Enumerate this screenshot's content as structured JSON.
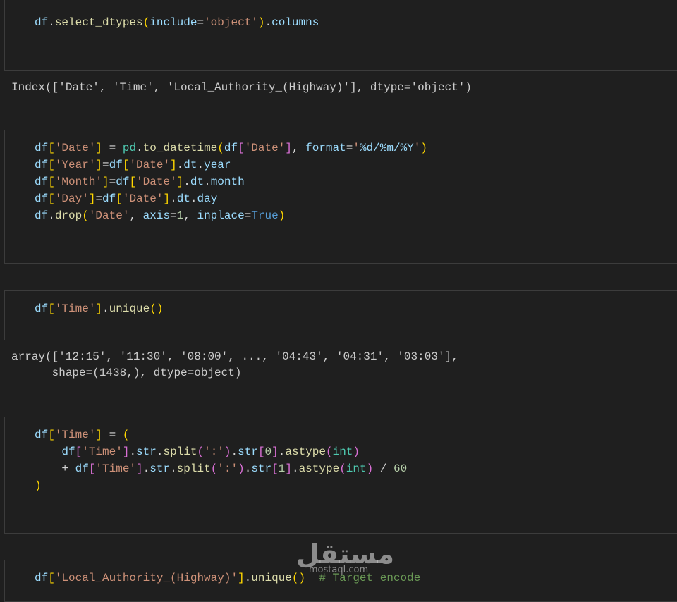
{
  "cells": [
    {
      "lines": [
        [
          "df",
          ".",
          "select_dtypes",
          "(",
          "include",
          "=",
          "'object'",
          ")",
          ".",
          "columns"
        ]
      ]
    },
    {
      "lines": [
        [
          "df",
          "[",
          "'Date'",
          "]",
          " = ",
          "pd",
          ".",
          "to_datetime",
          "(",
          "df",
          "[",
          "'Date'",
          "]",
          ", ",
          "format",
          "=",
          "'",
          "%d/%m/%Y",
          "'",
          ")"
        ],
        [
          "df",
          "[",
          "'Year'",
          "]",
          "=",
          "df",
          "[",
          "'Date'",
          "]",
          ".",
          "dt",
          ".",
          "year"
        ],
        [
          "df",
          "[",
          "'Month'",
          "]",
          "=",
          "df",
          "[",
          "'Date'",
          "]",
          ".",
          "dt",
          ".",
          "month"
        ],
        [
          "df",
          "[",
          "'Day'",
          "]",
          "=",
          "df",
          "[",
          "'Date'",
          "]",
          ".",
          "dt",
          ".",
          "day"
        ],
        [
          "df",
          ".",
          "drop",
          "(",
          "'Date'",
          ", ",
          "axis",
          "=",
          "1",
          ", ",
          "inplace",
          "=",
          "True",
          ")"
        ]
      ]
    },
    {
      "lines": [
        [
          "df",
          "[",
          "'Time'",
          "]",
          ".",
          "unique",
          "(",
          ")"
        ]
      ]
    },
    {
      "lines": [
        [
          "df",
          "[",
          "'Time'",
          "]",
          " = ",
          "("
        ],
        [
          "    ",
          "df",
          "[",
          "'Time'",
          "]",
          ".",
          "str",
          ".",
          "split",
          "(",
          "':'",
          ")",
          ".",
          "str",
          "[",
          "0",
          "]",
          ".",
          "astype",
          "(",
          "int",
          ")"
        ],
        [
          "    ",
          "+ ",
          "df",
          "[",
          "'Time'",
          "]",
          ".",
          "str",
          ".",
          "split",
          "(",
          "':'",
          ")",
          ".",
          "str",
          "[",
          "1",
          "]",
          ".",
          "astype",
          "(",
          "int",
          ")",
          " / ",
          "60"
        ],
        [
          ")"
        ]
      ]
    },
    {
      "lines": [
        [
          "df",
          "[",
          "'Local_Authority_(Highway)'",
          "]",
          ".",
          "unique",
          "(",
          ")",
          "  ",
          "# Target encode"
        ]
      ]
    }
  ],
  "outputs": [
    "Index(['Date', 'Time', 'Local_Authority_(Highway)'], dtype='object')",
    "array(['12:15', '11:30', '08:00', ..., '04:43', '04:31', '03:03'],",
    "      shape=(1438,), dtype=object)"
  ],
  "watermark": {
    "arabic": "مستقل",
    "latin": "mostaql.com"
  }
}
